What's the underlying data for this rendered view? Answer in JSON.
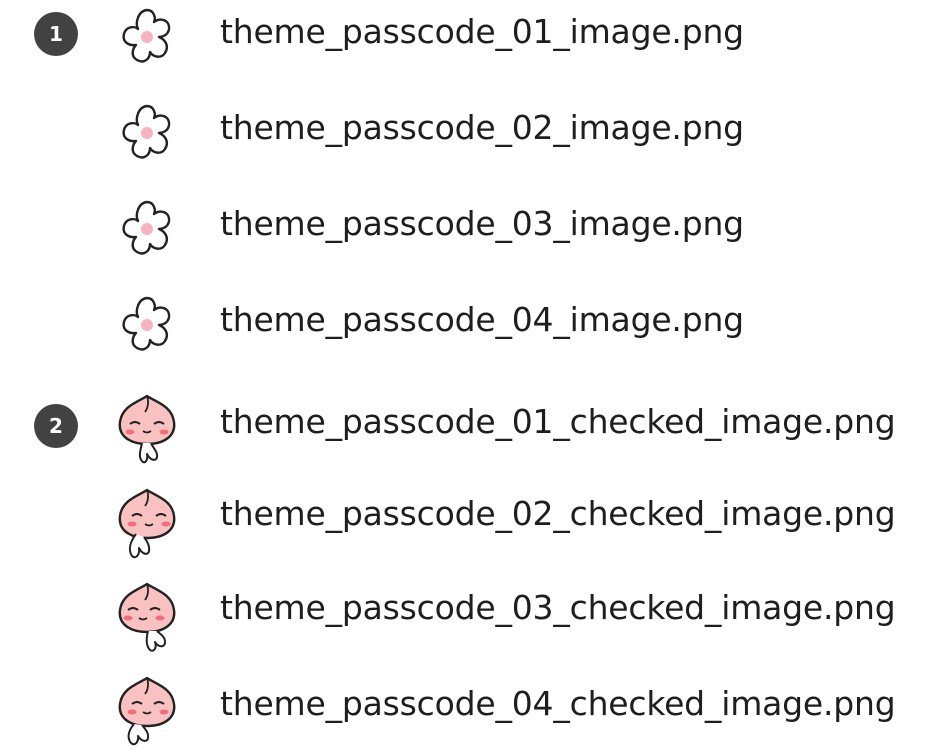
{
  "groups": [
    {
      "number": "1",
      "icon": "flower-icon"
    },
    {
      "number": "2",
      "icon": "peach-character-icon"
    }
  ],
  "files": [
    {
      "name": "theme_passcode_01_image.png",
      "icon": "flower-icon"
    },
    {
      "name": "theme_passcode_02_image.png",
      "icon": "flower-icon"
    },
    {
      "name": "theme_passcode_03_image.png",
      "icon": "flower-icon"
    },
    {
      "name": "theme_passcode_04_image.png",
      "icon": "flower-icon"
    },
    {
      "name": "theme_passcode_01_checked_image.png",
      "icon": "peach-character-icon"
    },
    {
      "name": "theme_passcode_02_checked_image.png",
      "icon": "peach-character-icon"
    },
    {
      "name": "theme_passcode_03_checked_image.png",
      "icon": "peach-character-icon"
    },
    {
      "name": "theme_passcode_04_checked_image.png",
      "icon": "peach-character-icon"
    }
  ],
  "colors": {
    "badge": "#424242",
    "flower_center": "#f7b3bf",
    "peach": "#f9c2c0",
    "blush": "#f26d7d"
  }
}
